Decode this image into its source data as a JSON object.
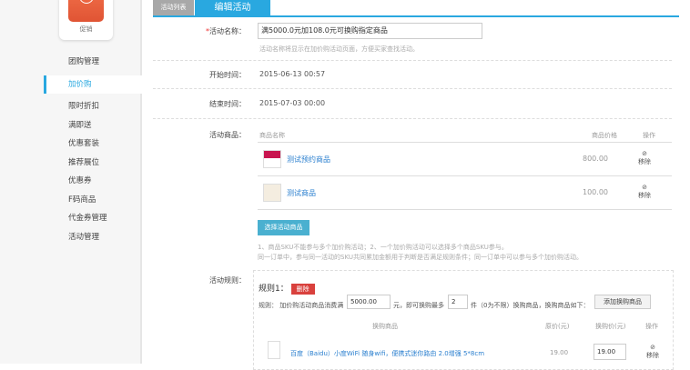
{
  "sidebar": {
    "logo_label": "促销",
    "items": [
      {
        "label": "团购管理"
      },
      {
        "label": "加价购",
        "active": true
      },
      {
        "label": "限时折扣"
      },
      {
        "label": "满即送"
      },
      {
        "label": "优惠套装"
      },
      {
        "label": "推荐展位"
      },
      {
        "label": "优惠券"
      },
      {
        "label": "F码商品"
      },
      {
        "label": "代金券管理"
      },
      {
        "label": "活动管理"
      }
    ]
  },
  "tabs": [
    {
      "label": "活动列表"
    },
    {
      "label": "编辑活动"
    }
  ],
  "form": {
    "name_label": "活动名称：",
    "name_required": "*",
    "name_value": "满5000.0元加108.0元可换购指定商品",
    "name_hint": "活动名称将显示在加价购活动页面，方便买家查找活动。",
    "start_label": "开始时间：",
    "start_value": "2015-06-13 00:57",
    "end_label": "结束时间：",
    "end_value": "2015-07-03 00:00",
    "products_label": "活动商品：",
    "products_header": {
      "name": "商品名称",
      "price": "商品价格",
      "op": "操作"
    },
    "products": [
      {
        "name": "测试预约商品",
        "price": "800.00",
        "op": "移除"
      },
      {
        "name": "测试商品",
        "price": "100.00",
        "op": "移除"
      }
    ],
    "select_button": "选择活动商品",
    "notes": [
      "1、商品SKU不能参与多个加价购活动；2、一个加价购活动可以选择多个商品SKU参与。",
      "同一订单中，参与同一活动的SKU共同累加金额用于判断是否满足规则条件；同一订单中可以参与多个加价购活动。"
    ],
    "rules_label": "活动规则：",
    "rule": {
      "title": "规则1：",
      "delete": "删除",
      "text1": "规则：",
      "text2": "加价购活动商品消费满",
      "amount": "5000.00",
      "text3": "元，即可换购最多",
      "count": "2",
      "text4": "件（0为不限）换购商品，换购商品如下：",
      "add_button": "添加换购商品",
      "header": {
        "name": "换购商品",
        "orig": "原价(元)",
        "price": "换购价(元)",
        "op": "操作"
      },
      "items": [
        {
          "name": "百度（Baidu）小度WiFi 随身wifi，便携式迷你路由 2.0增强 5*8cm",
          "orig": "19.00",
          "price": "19.00",
          "op": "移除"
        }
      ]
    }
  }
}
